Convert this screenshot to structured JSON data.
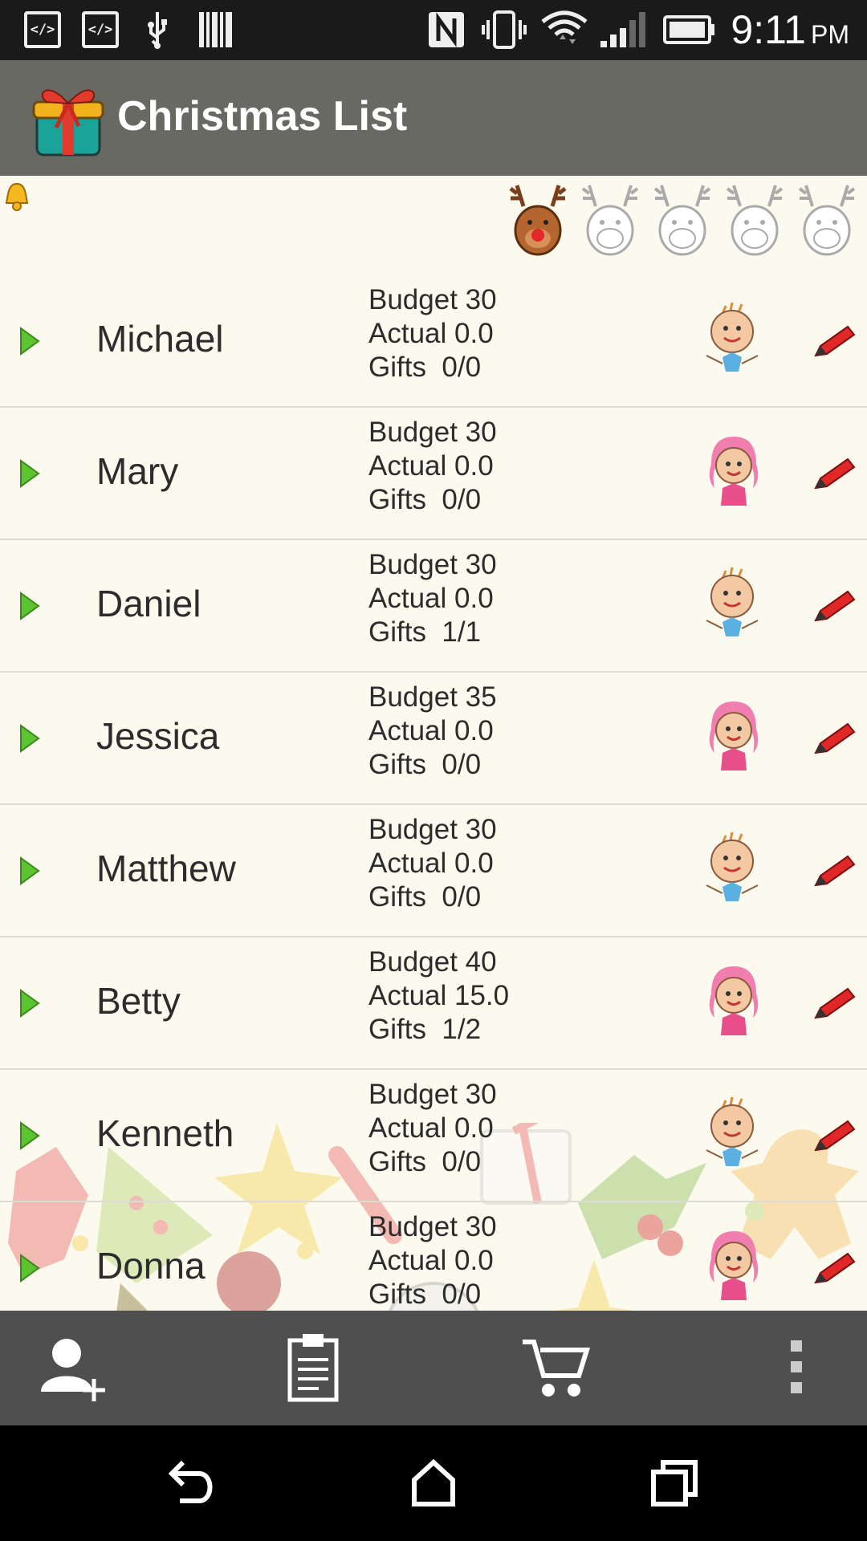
{
  "status_bar": {
    "time": "9:11",
    "ampm": "PM",
    "dev_icon_1": "</>",
    "dev_icon_2": "</>",
    "icons": [
      "code-icon",
      "code-icon",
      "usb-icon",
      "barcode-icon",
      "nfc-icon",
      "vibrate-icon",
      "wifi-icon",
      "signal-icon",
      "battery-icon"
    ]
  },
  "app_bar": {
    "title": "Christmas List",
    "logo_icon": "gift-icon"
  },
  "header": {
    "bell_icon": "bell-icon",
    "reindeer_count": 5,
    "reindeer_active": 1
  },
  "people": [
    {
      "name": "Michael",
      "budget": "Budget 30",
      "actual": "Actual 0.0",
      "gifts": "Gifts  0/0",
      "avatar": "boy"
    },
    {
      "name": "Mary",
      "budget": "Budget 30",
      "actual": "Actual 0.0",
      "gifts": "Gifts  0/0",
      "avatar": "girl"
    },
    {
      "name": "Daniel",
      "budget": "Budget 30",
      "actual": "Actual 0.0",
      "gifts": "Gifts  1/1",
      "avatar": "boy"
    },
    {
      "name": "Jessica",
      "budget": "Budget 35",
      "actual": "Actual 0.0",
      "gifts": "Gifts  0/0",
      "avatar": "girl"
    },
    {
      "name": "Matthew",
      "budget": "Budget 30",
      "actual": "Actual 0.0",
      "gifts": "Gifts  0/0",
      "avatar": "boy"
    },
    {
      "name": "Betty",
      "budget": "Budget 40",
      "actual": "Actual 15.0",
      "gifts": "Gifts  1/2",
      "avatar": "girl"
    },
    {
      "name": "Kenneth",
      "budget": "Budget 30",
      "actual": "Actual 0.0",
      "gifts": "Gifts  0/0",
      "avatar": "boy"
    },
    {
      "name": "Donna",
      "budget": "Budget 30",
      "actual": "Actual 0.0",
      "gifts": "Gifts  0/0",
      "avatar": "girl"
    }
  ],
  "toolbar": {
    "buttons": [
      "add-person-icon",
      "clipboard-icon",
      "cart-icon",
      "overflow-menu-icon"
    ]
  },
  "nav_bar": {
    "buttons": [
      "back-icon",
      "home-icon",
      "recents-icon"
    ]
  },
  "colors": {
    "app_bar": "#696964",
    "content_bg": "#fcfaef",
    "edit_red": "#e02828",
    "arrow_green": "#5cc430"
  }
}
